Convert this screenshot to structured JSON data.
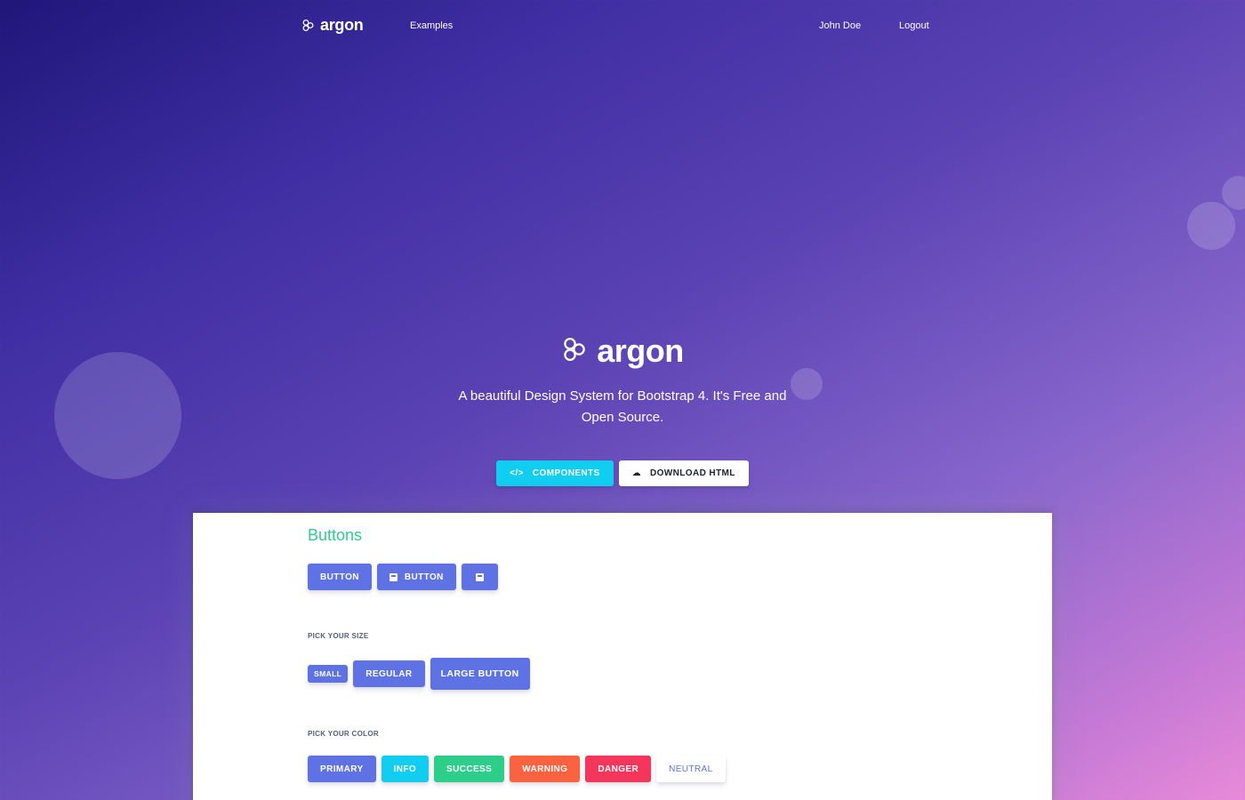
{
  "nav": {
    "brand": "argon",
    "links": {
      "examples": "Examples",
      "user": "John Doe",
      "logout": "Logout"
    }
  },
  "hero": {
    "brand": "argon",
    "subtitle": "A beautiful Design System for Bootstrap 4. It's Free and Open Source.",
    "components_label": "COMPONENTS",
    "download_label": "DOWNLOAD HTML"
  },
  "buttons_section": {
    "title": "Buttons",
    "row1": {
      "button": "BUTTON",
      "icon_button": "BUTTON"
    },
    "size_heading": "PICK YOUR SIZE",
    "sizes": {
      "small": "SMALL",
      "regular": "REGULAR",
      "large": "LARGE BUTTON"
    },
    "color_heading": "PICK YOUR COLOR",
    "colors": {
      "primary": "PRIMARY",
      "info": "INFO",
      "success": "SUCCESS",
      "warning": "WARNING",
      "danger": "DANGER",
      "neutral": "NEUTRAL"
    }
  },
  "icons": {
    "logo": "hexagons-logo-icon",
    "components": "code-icon",
    "download": "cloud-download-icon",
    "button": "calendar-icon"
  },
  "colors": {
    "primary": "#5e72e4",
    "info": "#11cdef",
    "success": "#2dce89",
    "warning": "#fb6340",
    "danger": "#f5365c"
  }
}
